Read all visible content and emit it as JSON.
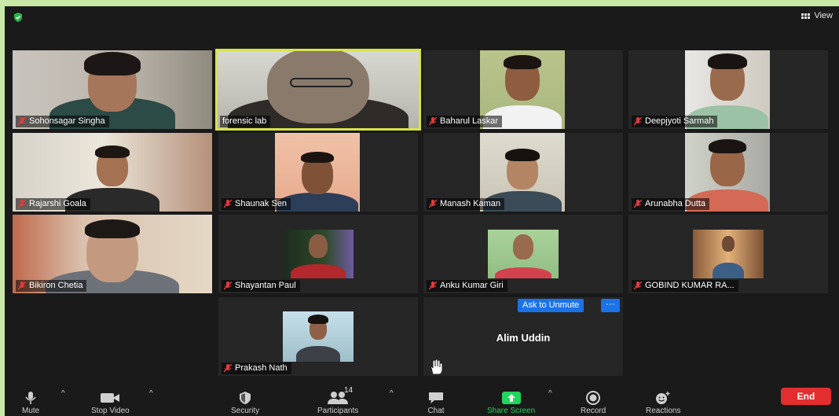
{
  "header": {
    "view_label": "View"
  },
  "participants": [
    {
      "name": "Sohonsagar Singha",
      "muted": true
    },
    {
      "name": "forensic lab",
      "muted": false,
      "active_speaker": true
    },
    {
      "name": "Baharul Laskar",
      "muted": true
    },
    {
      "name": "Deepjyoti Sarmah",
      "muted": true
    },
    {
      "name": "Rajarshi Goala",
      "muted": true
    },
    {
      "name": "Shaunak Sen",
      "muted": true
    },
    {
      "name": "Manash Kaman",
      "muted": true
    },
    {
      "name": "Arunabha Dutta",
      "muted": true
    },
    {
      "name": "Bikiron Chetia",
      "muted": true
    },
    {
      "name": "Shayantan Paul",
      "muted": true
    },
    {
      "name": "Anku Kumar Giri",
      "muted": true
    },
    {
      "name": "GOBIND KUMAR RA...",
      "muted": true
    },
    {
      "name": "Prakash Nath",
      "muted": true
    },
    {
      "name": "Alim Uddin",
      "video_off": true
    }
  ],
  "tile_actions": {
    "ask_to_unmute": "Ask to Unmute",
    "more": "···"
  },
  "toolbar": {
    "mute": "Mute",
    "stop_video": "Stop Video",
    "security": "Security",
    "participants": "Participants",
    "participants_count": "14",
    "chat": "Chat",
    "share_screen": "Share Screen",
    "record": "Record",
    "reactions": "Reactions",
    "end": "End"
  },
  "colors": {
    "active_speaker_border": "#d8e34a",
    "end_button": "#e22e2e",
    "share_green": "#24d35b",
    "unmute_blue": "#1a73e8"
  }
}
